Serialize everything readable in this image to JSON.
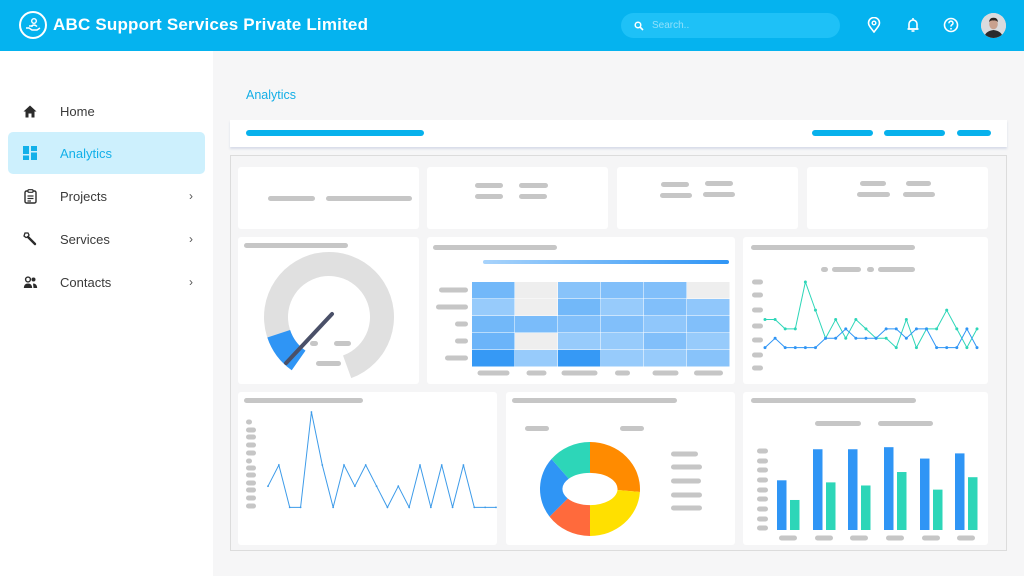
{
  "header": {
    "brand_title": "ABC Support Services Private Limited",
    "logo_icon": "hand-person-icon",
    "search_placeholder": "Search..",
    "search_value": "",
    "icons": [
      "location-pin-icon",
      "bell-icon",
      "help-icon"
    ],
    "avatar": "user-avatar"
  },
  "sidebar": {
    "items": [
      {
        "label": "Home",
        "icon": "home-icon",
        "active": false,
        "has_children": false
      },
      {
        "label": "Analytics",
        "icon": "dashboard-icon",
        "active": true,
        "has_children": false
      },
      {
        "label": "Projects",
        "icon": "clipboard-icon",
        "active": false,
        "has_children": true,
        "chevron": "›"
      },
      {
        "label": "Services",
        "icon": "wrench-icon",
        "active": false,
        "has_children": true,
        "chevron": "›"
      },
      {
        "label": "Contacts",
        "icon": "contacts-icon",
        "active": false,
        "has_children": true,
        "chevron": "›"
      }
    ]
  },
  "main": {
    "page_title": "Analytics"
  },
  "colors": {
    "brand": "#05b3ef",
    "active_bg": "#cdf0fd",
    "series_blue": "#2f95f5",
    "series_teal": "#2dd6b8",
    "skeleton": "#c6c6c6"
  },
  "chart_data": [
    {
      "type": "gauge",
      "title": "",
      "value_fraction": 0.12,
      "colors": {
        "track": "#e0e0e0",
        "fill": "#2f95f5",
        "needle": "#4a5068"
      }
    },
    {
      "type": "heatmap",
      "title": "",
      "rows": 5,
      "cols": 6,
      "values": [
        [
          0.55,
          0.0,
          0.4,
          0.45,
          0.45,
          0.0
        ],
        [
          0.3,
          0.0,
          0.55,
          0.3,
          0.45,
          0.35
        ],
        [
          0.55,
          0.5,
          0.45,
          0.45,
          0.35,
          0.45
        ],
        [
          0.6,
          0.0,
          0.3,
          0.3,
          0.45,
          0.3
        ],
        [
          0.95,
          0.3,
          0.95,
          0.3,
          0.3,
          0.4
        ]
      ],
      "colorscale": [
        "#eeeeee",
        "#2f95f5"
      ]
    },
    {
      "type": "line",
      "title": "",
      "series": [
        {
          "name": "",
          "color": "#2dd6b8",
          "values": [
            4,
            4,
            3,
            3,
            8,
            5,
            2,
            4,
            2,
            4,
            3,
            2,
            2,
            1,
            4,
            1,
            3,
            3,
            5,
            3,
            1,
            3
          ]
        },
        {
          "name": "",
          "color": "#2f95f5",
          "values": [
            1,
            2,
            1,
            1,
            1,
            1,
            2,
            2,
            3,
            2,
            2,
            2,
            3,
            3,
            2,
            3,
            3,
            1,
            1,
            1,
            3,
            1
          ]
        }
      ],
      "ylim": [
        0,
        8
      ]
    },
    {
      "type": "line",
      "title": "",
      "series": [
        {
          "name": "",
          "color": "#3d9be9",
          "values": [
            3,
            5,
            1,
            1,
            10,
            5,
            1,
            5,
            3,
            5,
            3,
            1,
            3,
            1,
            5,
            1,
            5,
            1,
            5,
            1,
            1,
            1
          ]
        }
      ],
      "ylim": [
        0,
        10
      ]
    },
    {
      "type": "pie",
      "title": "",
      "donut": true,
      "slices": [
        {
          "label": "",
          "value": 26,
          "color": "#ff8b00"
        },
        {
          "label": "",
          "value": 24,
          "color": "#ffe000"
        },
        {
          "label": "",
          "value": 15,
          "color": "#ff6a3c"
        },
        {
          "label": "",
          "value": 21,
          "color": "#2f95f5"
        },
        {
          "label": "",
          "value": 14,
          "color": "#2dd6b8"
        }
      ]
    },
    {
      "type": "bar",
      "title": "",
      "categories": [
        "",
        "",
        "",
        "",
        "",
        ""
      ],
      "series": [
        {
          "name": "",
          "color": "#2f95f5",
          "values": [
            48,
            78,
            78,
            80,
            69,
            74
          ]
        },
        {
          "name": "",
          "color": "#2dd6b8",
          "values": [
            29,
            46,
            43,
            56,
            39,
            51
          ]
        }
      ],
      "ylim": [
        0,
        85
      ]
    }
  ]
}
